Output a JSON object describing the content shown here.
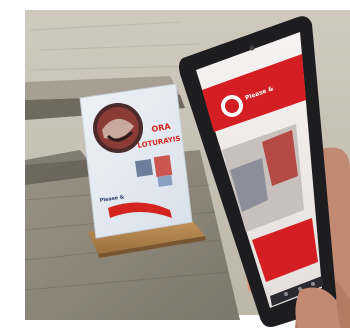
{
  "photo": {
    "subject": "",
    "colors": {
      "wall": "#c9c4b8",
      "ledge": "#a29b8d",
      "shelf": "#8e877a",
      "shadow": "#3f3b35",
      "easel_base": "#b7874d",
      "flyer_bg": "#e9eef4",
      "flyer_red": "#d3241f",
      "flyer_blue": "#5d84b8",
      "phone_body": "#1d1d20",
      "screen_red": "#d41e23",
      "screen_white": "#f4f2f0",
      "skin": "#c98e73"
    }
  },
  "flyer": {
    "headline_line1": "ORA",
    "headline_line2": "LOTURAYIS",
    "brand": "Please &"
  },
  "phone_screen": {
    "brand": "Please &"
  }
}
